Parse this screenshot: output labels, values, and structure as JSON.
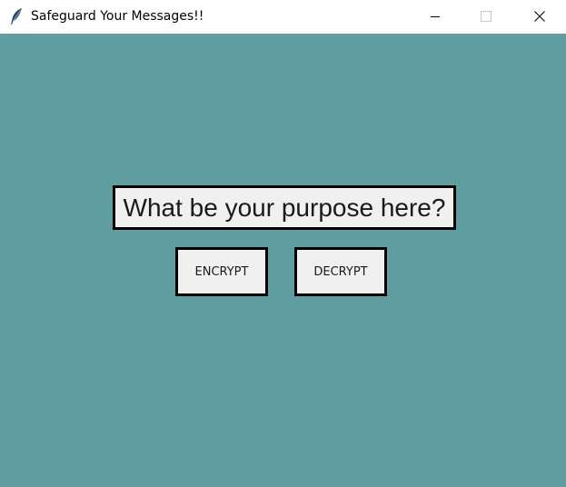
{
  "window": {
    "title": "Safeguard Your Messages!!",
    "app_icon": "feather-icon",
    "controls": {
      "minimize_icon": "minimize-icon",
      "maximize_icon": "maximize-icon",
      "close_icon": "close-icon"
    },
    "background_color": "#5f9ea0"
  },
  "main": {
    "prompt": "What be your purpose here?",
    "buttons": {
      "encrypt_label": "ENCRYPT",
      "decrypt_label": "DECRYPT"
    }
  }
}
